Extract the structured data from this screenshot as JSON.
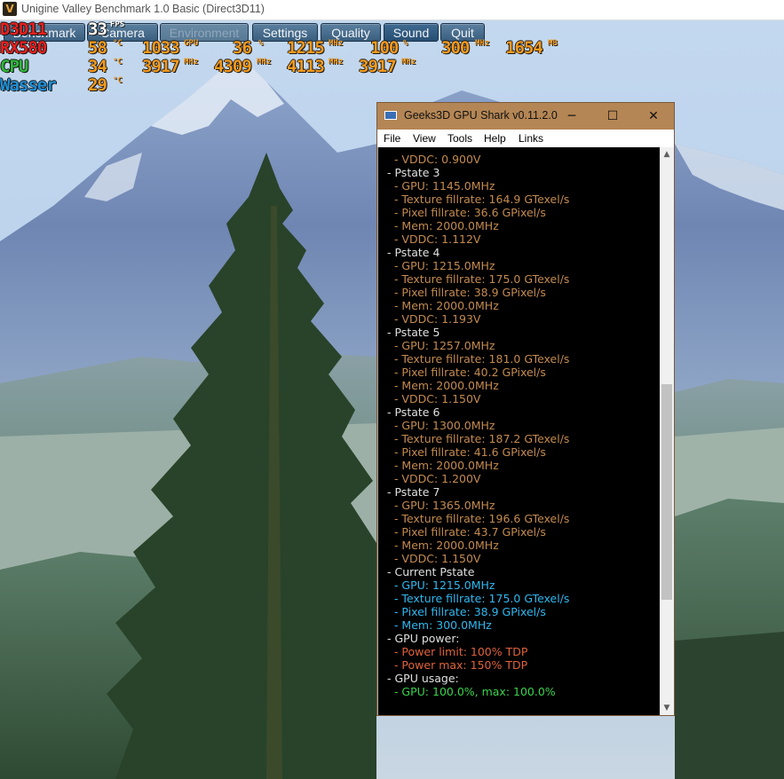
{
  "main_window": {
    "title": "Unigine Valley Benchmark 1.0 Basic (Direct3D11)",
    "icon": "V"
  },
  "valley_menu": {
    "buttons": [
      {
        "label": "Benchmark"
      },
      {
        "label": "Camera"
      },
      {
        "label": "Environment"
      },
      {
        "label": "Settings"
      },
      {
        "label": "Quality"
      },
      {
        "label": "Sound"
      },
      {
        "label": "Quit"
      }
    ]
  },
  "osd": {
    "api": "D3D11",
    "fps": {
      "value": "33",
      "unit": "FPS"
    },
    "rows": [
      {
        "label": "RX580",
        "color": "#e8201e",
        "values": [
          {
            "v": "58",
            "u": "°C"
          },
          {
            "v": "1033",
            "u": "GPU"
          },
          {
            "v": "36",
            "u": "%"
          },
          {
            "v": "1215",
            "u": "MHz"
          },
          {
            "v": "100",
            "u": "%"
          },
          {
            "v": "300",
            "u": "MHz"
          },
          {
            "v": "1654",
            "u": "MB"
          }
        ]
      },
      {
        "label": "CPU",
        "color": "#2fb63a",
        "values": [
          {
            "v": "34",
            "u": "°C"
          },
          {
            "v": "3917",
            "u": "MHz"
          },
          {
            "v": "4309",
            "u": "MHz"
          },
          {
            "v": "4113",
            "u": "MHz"
          },
          {
            "v": "3917",
            "u": "MHz"
          }
        ]
      },
      {
        "label": "Wasser",
        "color": "#1f8fd6",
        "values": [
          {
            "v": "29",
            "u": "°C"
          }
        ]
      }
    ],
    "value_color": "#f39a1e"
  },
  "shark": {
    "title": "Geeks3D GPU Shark v0.11.2.0",
    "controls": {
      "minimize": "─",
      "maximize": "☐",
      "close": "✕"
    },
    "menu": [
      "File",
      "View",
      "Tools",
      "Help",
      "Links"
    ],
    "scroll_up": "▲",
    "scroll_down": "▼",
    "lines": [
      {
        "text": "  - VDDC: 0.900V",
        "cls": "c-brown"
      },
      {
        "text": "- Pstate 3",
        "cls": "c-head"
      },
      {
        "text": "  - GPU: 1145.0MHz",
        "cls": "c-brown"
      },
      {
        "text": "  - Texture fillrate: 164.9 GTexel/s",
        "cls": "c-brown"
      },
      {
        "text": "  - Pixel fillrate: 36.6 GPixel/s",
        "cls": "c-brown"
      },
      {
        "text": "  - Mem: 2000.0MHz",
        "cls": "c-brown"
      },
      {
        "text": "  - VDDC: 1.112V",
        "cls": "c-brown"
      },
      {
        "text": "- Pstate 4",
        "cls": "c-head"
      },
      {
        "text": "  - GPU: 1215.0MHz",
        "cls": "c-brown"
      },
      {
        "text": "  - Texture fillrate: 175.0 GTexel/s",
        "cls": "c-brown"
      },
      {
        "text": "  - Pixel fillrate: 38.9 GPixel/s",
        "cls": "c-brown"
      },
      {
        "text": "  - Mem: 2000.0MHz",
        "cls": "c-brown"
      },
      {
        "text": "  - VDDC: 1.193V",
        "cls": "c-brown"
      },
      {
        "text": "- Pstate 5",
        "cls": "c-head"
      },
      {
        "text": "  - GPU: 1257.0MHz",
        "cls": "c-brown"
      },
      {
        "text": "  - Texture fillrate: 181.0 GTexel/s",
        "cls": "c-brown"
      },
      {
        "text": "  - Pixel fillrate: 40.2 GPixel/s",
        "cls": "c-brown"
      },
      {
        "text": "  - Mem: 2000.0MHz",
        "cls": "c-brown"
      },
      {
        "text": "  - VDDC: 1.150V",
        "cls": "c-brown"
      },
      {
        "text": "- Pstate 6",
        "cls": "c-head"
      },
      {
        "text": "  - GPU: 1300.0MHz",
        "cls": "c-brown"
      },
      {
        "text": "  - Texture fillrate: 187.2 GTexel/s",
        "cls": "c-brown"
      },
      {
        "text": "  - Pixel fillrate: 41.6 GPixel/s",
        "cls": "c-brown"
      },
      {
        "text": "  - Mem: 2000.0MHz",
        "cls": "c-brown"
      },
      {
        "text": "  - VDDC: 1.200V",
        "cls": "c-brown"
      },
      {
        "text": "- Pstate 7",
        "cls": "c-head"
      },
      {
        "text": "  - GPU: 1365.0MHz",
        "cls": "c-brown"
      },
      {
        "text": "  - Texture fillrate: 196.6 GTexel/s",
        "cls": "c-brown"
      },
      {
        "text": "  - Pixel fillrate: 43.7 GPixel/s",
        "cls": "c-brown"
      },
      {
        "text": "  - Mem: 2000.0MHz",
        "cls": "c-brown"
      },
      {
        "text": "  - VDDC: 1.150V",
        "cls": "c-brown"
      },
      {
        "text": "- Current Pstate",
        "cls": "c-head"
      },
      {
        "text": "  - GPU: 1215.0MHz",
        "cls": "c-cyan"
      },
      {
        "text": "  - Texture fillrate: 175.0 GTexel/s",
        "cls": "c-cyan"
      },
      {
        "text": "  - Pixel fillrate: 38.9 GPixel/s",
        "cls": "c-cyan"
      },
      {
        "text": "  - Mem: 300.0MHz",
        "cls": "c-cyan"
      },
      {
        "text": "- GPU power:",
        "cls": "c-head"
      },
      {
        "text": "  - Power limit: 100% TDP",
        "cls": "c-red"
      },
      {
        "text": "  - Power max: 150% TDP",
        "cls": "c-red"
      },
      {
        "text": "- GPU usage:",
        "cls": "c-head"
      },
      {
        "text": "  - GPU: 100.0%, max: 100.0%",
        "cls": "c-green"
      }
    ]
  }
}
